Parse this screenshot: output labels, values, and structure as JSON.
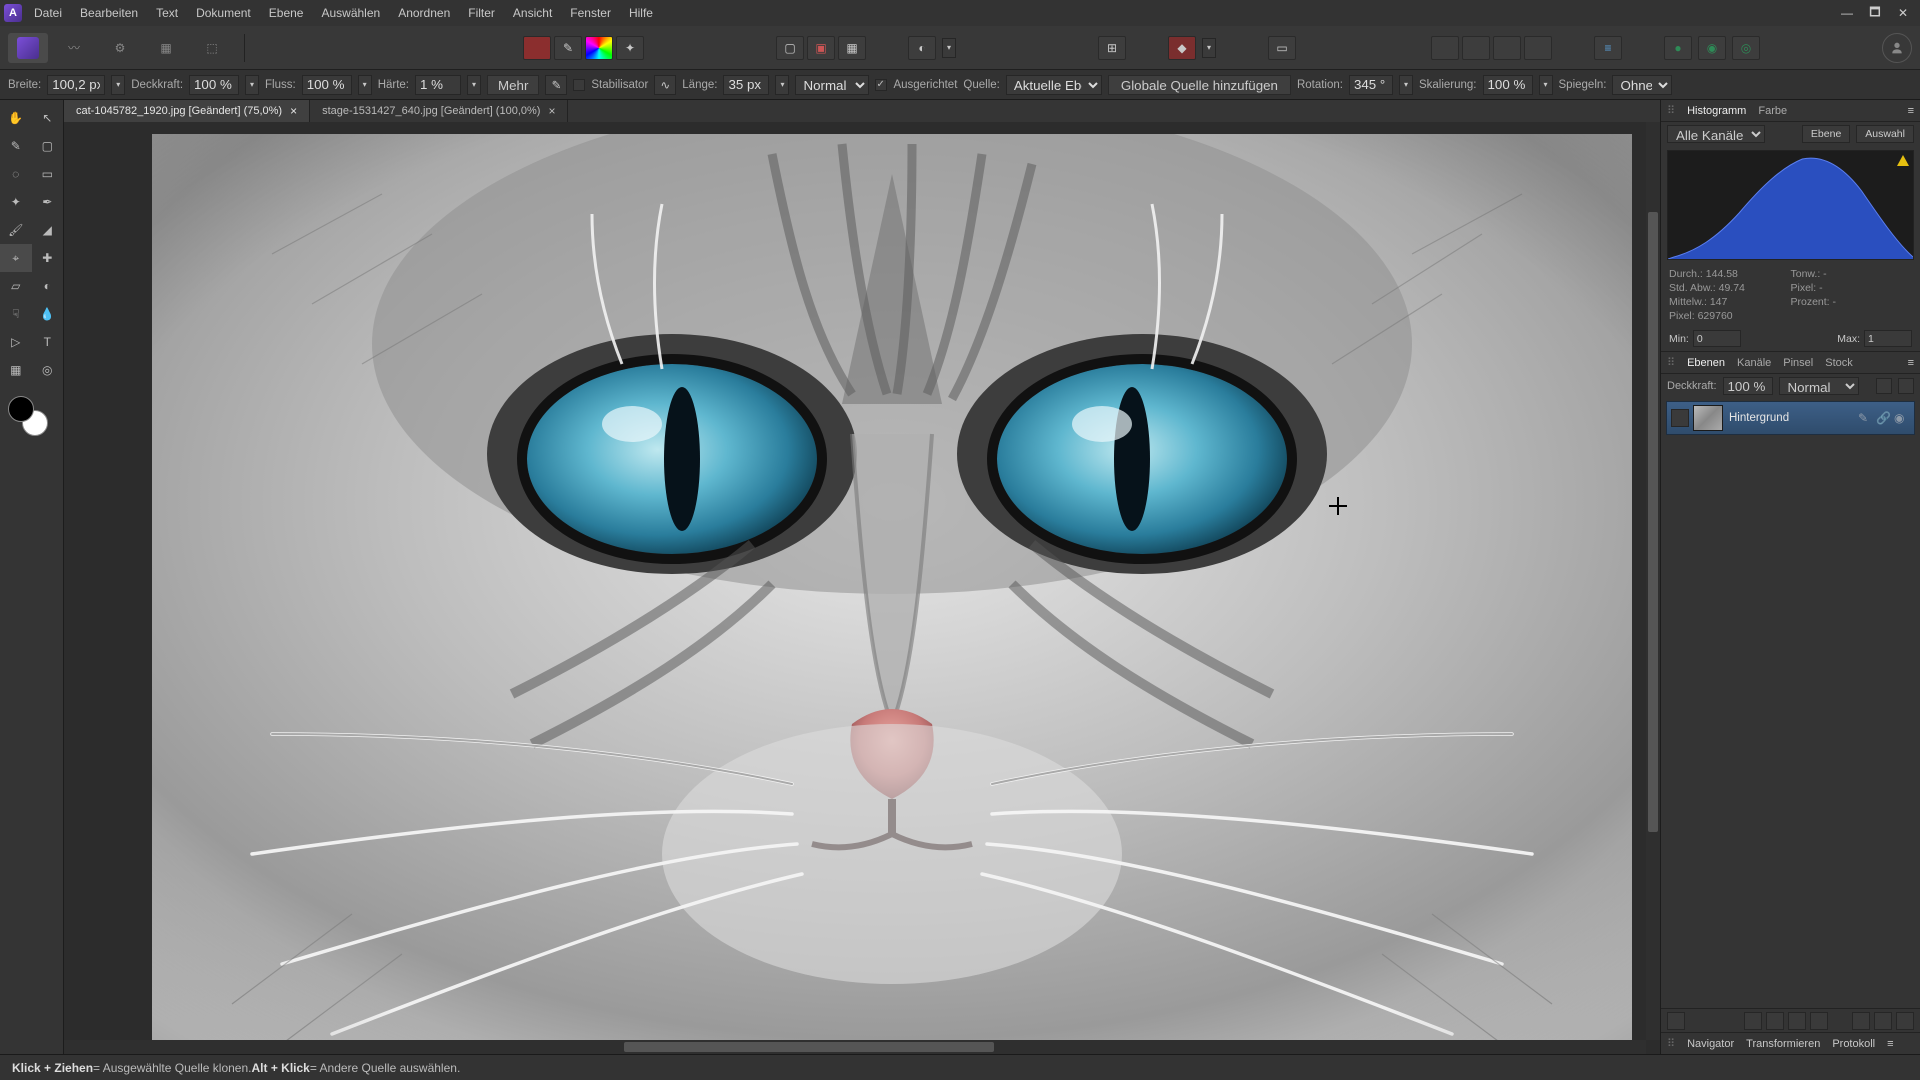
{
  "menu": [
    "Datei",
    "Bearbeiten",
    "Text",
    "Dokument",
    "Ebene",
    "Auswählen",
    "Anordnen",
    "Filter",
    "Ansicht",
    "Fenster",
    "Hilfe"
  ],
  "optbar": {
    "breite_label": "Breite:",
    "breite": "100,2 px",
    "deckkraft_label": "Deckkraft:",
    "deckkraft": "100 %",
    "fluss_label": "Fluss:",
    "fluss": "100 %",
    "haerte_label": "Härte:",
    "haerte": "1 %",
    "mehr": "Mehr",
    "stabilisator": "Stabilisator",
    "laenge_label": "Länge:",
    "laenge": "35 px",
    "mode": "Normal",
    "ausgerichtet": "Ausgerichtet",
    "quelle_label": "Quelle:",
    "quelle": "Aktuelle Ebene",
    "globale": "Globale Quelle hinzufügen",
    "rotation_label": "Rotation:",
    "rotation": "345 °",
    "skalierung_label": "Skalierung:",
    "skalierung": "100 %",
    "spiegeln_label": "Spiegeln:",
    "spiegeln": "Ohne"
  },
  "tabs": {
    "t1": "cat-1045782_1920.jpg [Geändert] (75,0%)",
    "t2": "stage-1531427_640.jpg [Geändert] (100,0%)"
  },
  "hist": {
    "tab1": "Histogramm",
    "tab2": "Farbe",
    "channels": "Alle Kanäle",
    "ebene": "Ebene",
    "auswahl": "Auswahl",
    "durch": "Durch.: 144.58",
    "stdabw": "Std. Abw.: 49.74",
    "mittelw": "Mittelw.: 147",
    "pixel": "Pixel: 629760",
    "tonw": "Tonw.: -",
    "pixel2": "Pixel: -",
    "prozent": "Prozent: -",
    "min_label": "Min:",
    "min": "0",
    "max_label": "Max:",
    "max": "1"
  },
  "layers": {
    "tab1": "Ebenen",
    "tab2": "Kanäle",
    "tab3": "Pinsel",
    "tab4": "Stock",
    "opac_label": "Deckkraft:",
    "opac": "100 %",
    "blend": "Normal",
    "layer_name": "Hintergrund"
  },
  "bottom_tabs": {
    "t1": "Navigator",
    "t2": "Transformieren",
    "t3": "Protokoll"
  },
  "status": {
    "kd": "Klick + Ziehen",
    "kd_desc": " = Ausgewählte Quelle klonen. ",
    "ak": "Alt + Klick",
    "ak_desc": " = Andere Quelle auswählen."
  }
}
